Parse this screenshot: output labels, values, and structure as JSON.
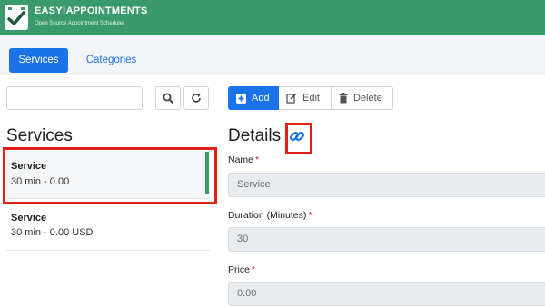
{
  "app": {
    "title": "EASY!APPOINTMENTS",
    "subtitle": "Open Source Appointment Scheduler",
    "brand_color": "#3a9a6c"
  },
  "tabs": [
    {
      "label": "Services",
      "active": true
    },
    {
      "label": "Categories",
      "active": false
    }
  ],
  "search": {
    "value": "",
    "placeholder": ""
  },
  "list": {
    "title": "Services",
    "items": [
      {
        "name": "Service",
        "meta": "30 min - 0.00",
        "selected": true
      },
      {
        "name": "Service",
        "meta": "30 min - 0.00 USD",
        "selected": false
      }
    ]
  },
  "toolbar": {
    "add": "Add",
    "edit": "Edit",
    "delete": "Delete"
  },
  "details": {
    "title": "Details",
    "fields": [
      {
        "label": "Name",
        "required": "*",
        "value": "Service"
      },
      {
        "label": "Duration (Minutes)",
        "required": "*",
        "value": "30"
      },
      {
        "label": "Price",
        "required": "*",
        "value": "0.00"
      }
    ]
  },
  "colors": {
    "primary": "#1a73e8",
    "highlight": "#e21f14",
    "accent": "#3a9a6c"
  },
  "icons": [
    "checkmark-logo-icon",
    "search-icon",
    "reload-icon",
    "plus-square-icon",
    "edit-icon",
    "trash-icon",
    "link-icon"
  ]
}
